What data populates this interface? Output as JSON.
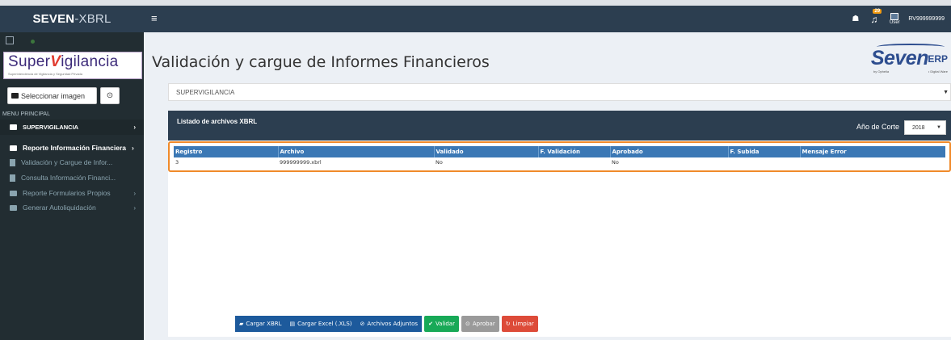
{
  "topbar": {
    "brand_bold": "SEVEN",
    "brand_rest": "-XBRL",
    "menu_icon": "hamburger-icon",
    "notification_count": "29",
    "user_img_alt": "User",
    "username": "RV999999999"
  },
  "sidebar": {
    "logo_text_a": "Super",
    "logo_text_v": "V",
    "logo_text_b": "igilancia",
    "logo_subtitle": "Superintendencia de Vigilancia y Seguridad Privada",
    "select_image_label": "Seleccionar imagen",
    "menu_header": "MENU PRINCIPAL",
    "items": [
      {
        "label": "SUPERVIGILANCIA",
        "chevron": "›"
      },
      {
        "label": "Reporte Información Financiera",
        "chevron": "›"
      },
      {
        "label": "Validación y Cargue de Infor..."
      },
      {
        "label": "Consulta Información Financi..."
      },
      {
        "label": "Reporte Formularios Propios",
        "chevron": "›"
      },
      {
        "label": "Generar Autoliquidación",
        "chevron": "›"
      }
    ]
  },
  "main": {
    "title": "Validación y cargue de Informes Financieros",
    "erp_logo": {
      "seven": "Seven",
      "erp": "-ERP",
      "by": "by Ophelia",
      "dw": "• Digital Ware"
    },
    "org_select": "SUPERVIGILANCIA",
    "panel_title": "Listado de archivos XBRL",
    "year_label": "Año de Corte",
    "year_value": "2018",
    "table": {
      "headers": [
        "Registro",
        "Archivo",
        "Validado",
        "F. Validación",
        "Aprobado",
        "F. Subida",
        "Mensaje Error"
      ],
      "rows": [
        [
          "3",
          "999999999.xbrl",
          "No",
          "",
          "No",
          "",
          ""
        ]
      ]
    },
    "buttons": {
      "cargar_xbrl": "Cargar XBRL",
      "cargar_excel": "Cargar Excel (.XLS)",
      "archivos": "Archivos Adjuntos",
      "validar": "Validar",
      "aprobar": "Aprobar",
      "limpiar": "Limpiar"
    }
  },
  "colors": {
    "navy": "#2c3e50",
    "sidebar": "#222d32",
    "table_header": "#3b78b5",
    "highlight": "#f08a2a",
    "green": "#18a957",
    "red": "#dd4b39"
  }
}
